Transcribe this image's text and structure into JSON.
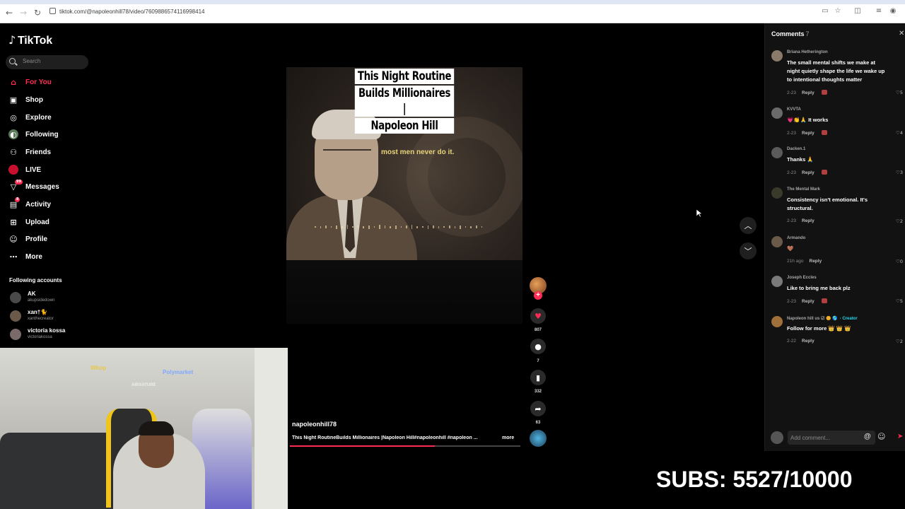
{
  "browser": {
    "url": "tiktok.com/@napoleonhill78/video/7609886574116998414"
  },
  "sidebar": {
    "logo": "TikTok",
    "search_placeholder": "Search",
    "items": [
      {
        "label": "For You",
        "icon": "home-icon",
        "active": true
      },
      {
        "label": "Shop",
        "icon": "shop-icon"
      },
      {
        "label": "Explore",
        "icon": "compass-icon"
      },
      {
        "label": "Following",
        "icon": "following-icon"
      },
      {
        "label": "Friends",
        "icon": "friends-icon"
      },
      {
        "label": "LIVE",
        "icon": "live-icon"
      },
      {
        "label": "Messages",
        "icon": "messages-icon",
        "badge": "99"
      },
      {
        "label": "Activity",
        "icon": "activity-icon",
        "badge": "8"
      },
      {
        "label": "Upload",
        "icon": "upload-icon"
      },
      {
        "label": "Profile",
        "icon": "profile-icon"
      },
      {
        "label": "More",
        "icon": "more-icon"
      }
    ],
    "following_title": "Following accounts",
    "following": [
      {
        "name": "AK",
        "handle": "akupsidedown"
      },
      {
        "name": "xan†🐈",
        "handle": "xanthecreator"
      },
      {
        "name": "victoria kossa",
        "handle": "victoriakossa"
      }
    ]
  },
  "video": {
    "title_lines": [
      "This Night Routine",
      "Builds Millionaires |",
      "Napoleon Hill"
    ],
    "caption": "most men never do it.",
    "author": "napoleonhill78",
    "description": "This Night RoutineBuilds Millionaires |Napoleon Hill#napoleonhill #napoleon ...",
    "more_label": "more",
    "progress": 0.63
  },
  "actions": {
    "likes": "807",
    "comments": "7",
    "saves": "332",
    "shares": "63"
  },
  "comments_panel": {
    "title": "Comments",
    "count": "7",
    "items": [
      {
        "user": "Briana Hetherington",
        "text": "The small mental shifts we make at night quietly shape the life we wake up to intentional thoughts matter",
        "date": "2-23",
        "reply": "Reply",
        "likes": "5",
        "creator_heart": true
      },
      {
        "user": "KVVTA",
        "text": "💗👏🙏 It works",
        "date": "2-23",
        "reply": "Reply",
        "likes": "4",
        "creator_heart": true
      },
      {
        "user": "Dacken.1",
        "text": "Thanks 🙏",
        "date": "2-23",
        "reply": "Reply",
        "likes": "3",
        "creator_heart": true
      },
      {
        "user": "The Mental Mark",
        "text": "Consistency isn't emotional. It's structural.",
        "date": "2-23",
        "reply": "Reply",
        "likes": "2",
        "creator_heart": false
      },
      {
        "user": "Armando",
        "text": "🤎",
        "date": "21h ago",
        "reply": "Reply",
        "likes": "0",
        "creator_heart": false
      },
      {
        "user": "Joseph Eccles",
        "text": "Like to bring me back plz",
        "date": "2-23",
        "reply": "Reply",
        "likes": "5",
        "creator_heart": true
      },
      {
        "user": "Napoleon hill us ☑ 🌼 🌎",
        "creator_label": "· Creator",
        "text": "Follow for more 👑 👑 👑",
        "date": "2-22",
        "reply": "Reply",
        "likes": "2",
        "creator_heart": false
      }
    ],
    "input_placeholder": "Add comment...",
    "at_symbol": "@",
    "emoji_symbol": "☺"
  },
  "overlay": {
    "subs": "SUBS: 5527/10000",
    "webcam_logo1": "Whop",
    "webcam_logo2": "Polymarket",
    "webcam_logo3": "AIRXATURE"
  }
}
